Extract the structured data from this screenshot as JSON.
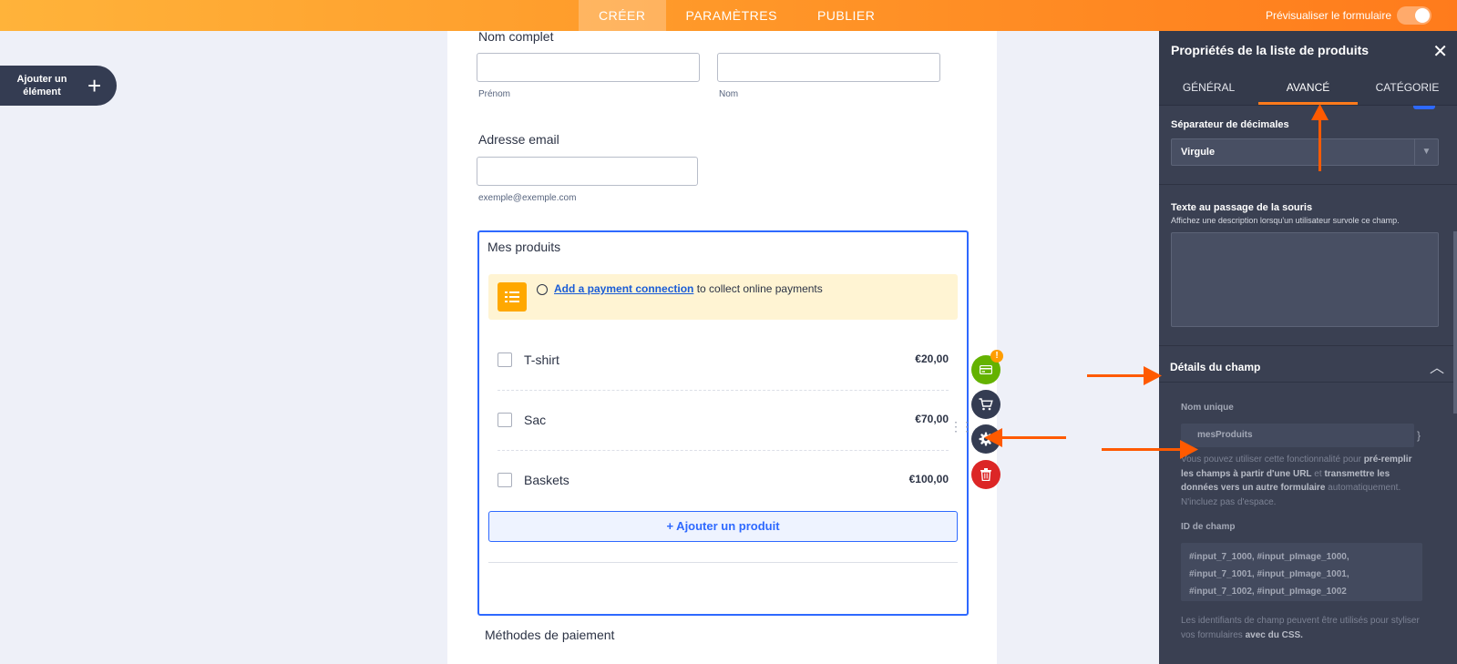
{
  "topbar": {
    "tabs": [
      {
        "label": "CRÉER",
        "active": true
      },
      {
        "label": "PARAMÈTRES",
        "active": false
      },
      {
        "label": "PUBLIER",
        "active": false
      }
    ],
    "preview_label": "Prévisualiser le formulaire"
  },
  "add_element": {
    "label": "Ajouter un élément"
  },
  "form": {
    "full_name": {
      "label": "Nom complet",
      "first_sublabel": "Prénom",
      "last_sublabel": "Nom"
    },
    "email": {
      "label": "Adresse email",
      "sublabel": "exemple@exemple.com"
    },
    "products": {
      "label": "Mes produits",
      "notice_link": "Add a payment connection",
      "notice_text": " to collect online payments",
      "items": [
        {
          "name": "T-shirt",
          "price": "€20,00"
        },
        {
          "name": "Sac",
          "price": "€70,00"
        },
        {
          "name": "Baskets",
          "price": "€100,00"
        }
      ],
      "add_button": "+ Ajouter un produit"
    },
    "payment_methods": {
      "label": "Méthodes de paiement"
    }
  },
  "fab": {
    "badge": "!"
  },
  "panel": {
    "title": "Propriétés de la liste de produits",
    "tabs": [
      {
        "label": "GÉNÉRAL",
        "active": false
      },
      {
        "label": "AVANCÉ",
        "active": true
      },
      {
        "label": "CATÉGORIE",
        "active": false
      }
    ],
    "decimal_separator": {
      "label": "Séparateur de décimales",
      "value": "Virgule"
    },
    "hover_text": {
      "label": "Texte au passage de la souris",
      "description": "Affichez une description lorsqu'un utilisateur survole ce champ."
    },
    "field_details": {
      "title": "Détails du champ",
      "unique_name_label": "Nom unique",
      "unique_name_value": "mesProduits",
      "help_1": "Vous pouvez utiliser cette fonctionnalité pour ",
      "help_2": "pré-remplir les champs à partir d'une URL",
      "help_3": " et ",
      "help_4": "transmettre les données vers un autre formulaire",
      "help_5": " automatiquement. N'incluez pas d'espace.",
      "field_id_label": "ID de champ",
      "field_ids": [
        "#input_7_1000, #input_pImage_1000,",
        "#input_7_1001, #input_pImage_1001,",
        "#input_7_1002, #input_pImage_1002"
      ],
      "ids_help_1": "Les identifiants de champ peuvent être utilisés pour styliser vos formulaires ",
      "ids_help_2": "avec du CSS."
    }
  },
  "colors": {
    "accent": "#ff7b1c",
    "selection": "#2e69ff",
    "panel": "#3a4052",
    "annotation": "#ff5a00"
  }
}
